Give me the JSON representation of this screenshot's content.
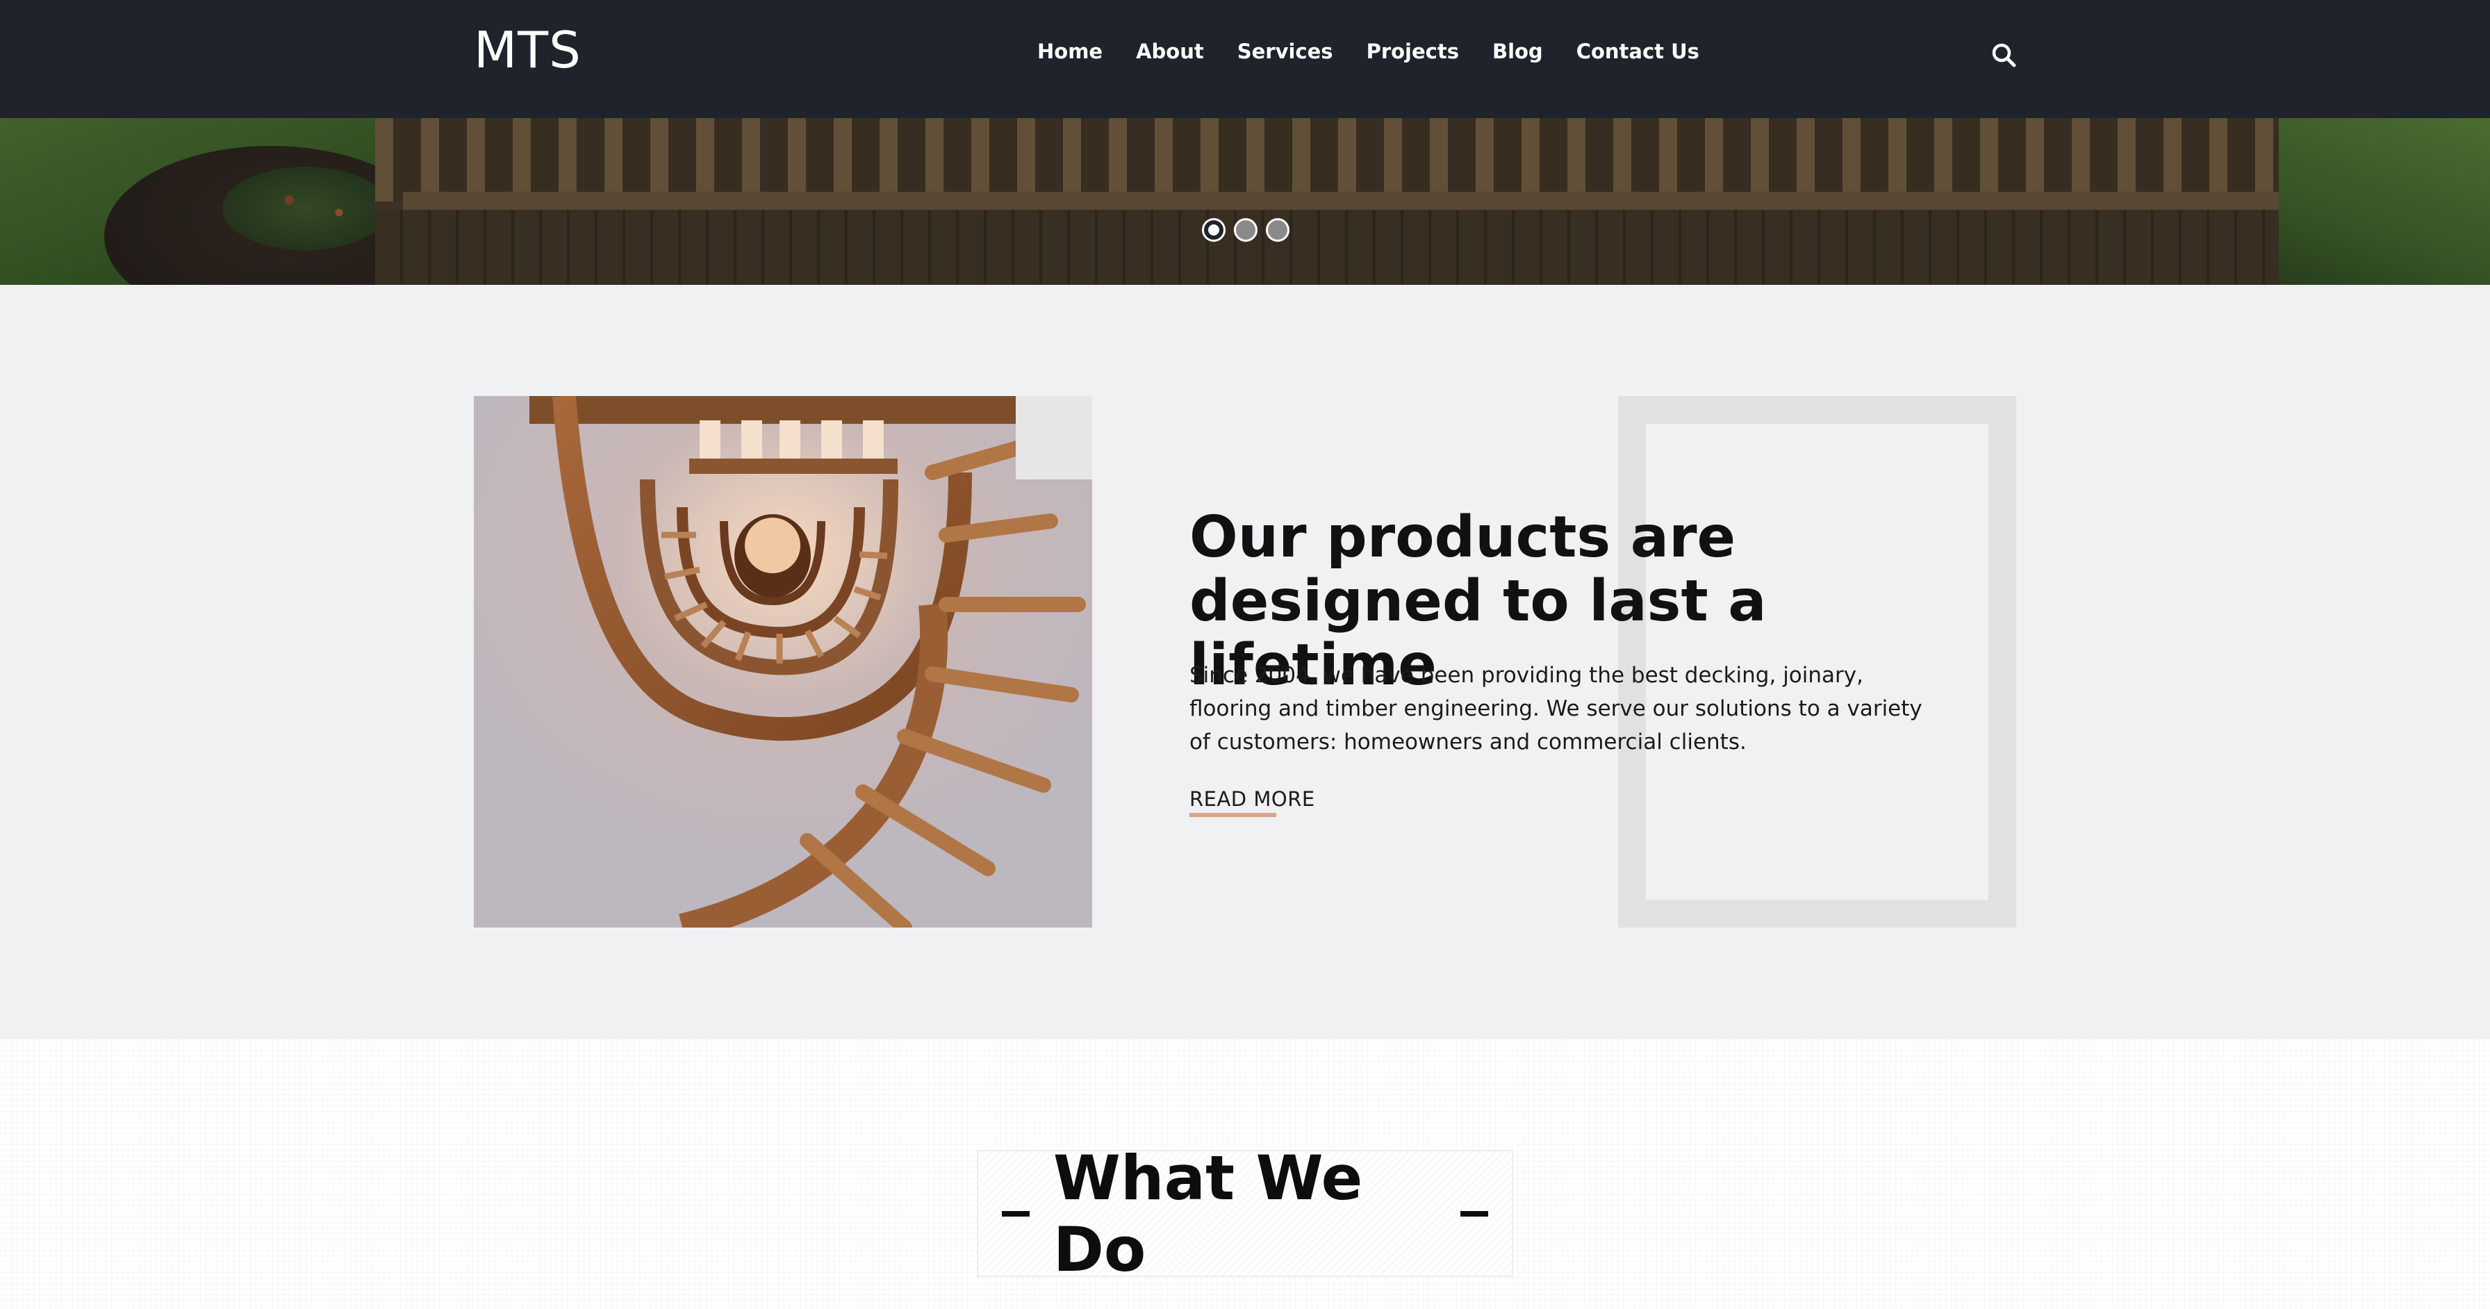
{
  "header": {
    "logo": "MTS",
    "nav": [
      "Home",
      "About",
      "Services",
      "Projects",
      "Blog",
      "Contact Us"
    ]
  },
  "hero": {
    "slides_count": 3,
    "active_slide": 1
  },
  "about": {
    "title": "Our products are designed to last a lifetime",
    "text": "Since 2004, we have been providing the best decking, joinary, flooring and timber engineering. We serve our solutions to a variety of customers: homeowners and commercial clients.",
    "read_more": "READ MORE"
  },
  "what_we_do": {
    "title": "What We Do"
  },
  "colors": {
    "header_bg": "#1f232b",
    "section_bg": "#f0f1f3",
    "accent": "#d9a58e"
  }
}
